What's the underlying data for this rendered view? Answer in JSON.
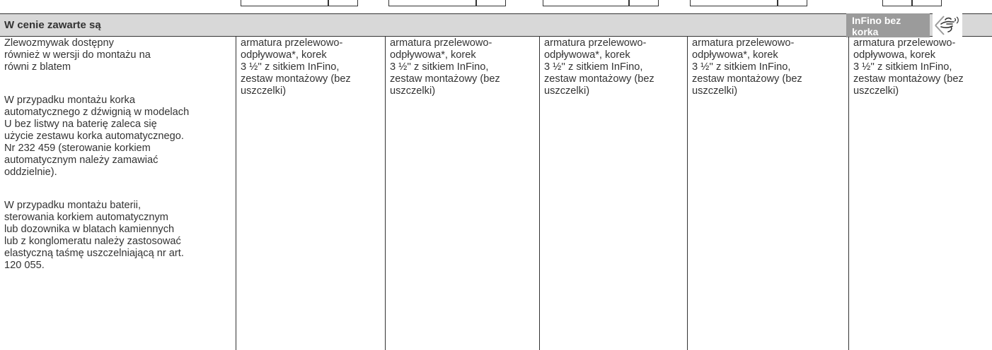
{
  "header": {
    "title": "W cenie zawarte są",
    "badge": "InFino bez korka\nautomatycznego",
    "icon": "hand-touch-icon",
    "background_color": "#d8d8d8",
    "badge_color": "#9b9b9b"
  },
  "first_column": [
    "Zlewozmywak dostępny\nrównież w wersji do montażu na\nrówni z blatem",
    "W przypadku montażu korka\nautomatycznego z dźwignią w modelach\nU bez listwy na baterię zaleca się\nużycie zestawu korka automatycznego.\nNr 232 459 (sterowanie korkiem\nautomatycznym należy zamawiać\noddzielnie).",
    "W przypadku montażu baterii,\nsterowania korkiem automatycznym\nlub dozownika w blatach kamiennych\nlub z konglomeratu należy zastosować\nelastyczną taśmę uszczelniającą nr art.\n120 055."
  ],
  "columns": [
    "armatura przelewowo-\nodpływowa*, korek\n3 ½'' z sitkiem InFino,\nzestaw montażowy (bez\nuszczelki)",
    "armatura przelewowo-\nodpływowa*, korek\n3 ½'' z sitkiem InFino,\nzestaw montażowy (bez\nuszczelki)",
    "armatura przelewowo-\nodpływowa*, korek\n3 ½'' z sitkiem InFino,\nzestaw montażowy (bez\nuszczelki)",
    "armatura przelewowo-\nodpływowa*, korek\n3 ½'' z sitkiem InFino,\nzestaw montażowy (bez\nuszczelki)",
    "armatura przelewowo-\nodpływowa, korek\n3 ½'' z sitkiem InFino,\nzestaw montażowy (bez\nuszczelki)"
  ]
}
